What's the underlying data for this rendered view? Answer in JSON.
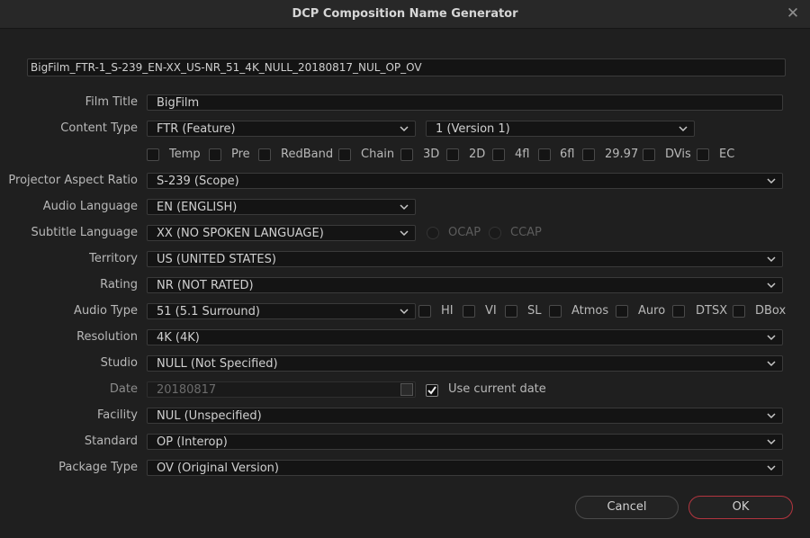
{
  "window": {
    "title": "DCP Composition Name Generator"
  },
  "generated_name": "BigFilm_FTR-1_S-239_EN-XX_US-NR_51_4K_NULL_20180817_NUL_OP_OV",
  "labels": {
    "film_title": "Film Title",
    "content_type": "Content Type",
    "projector_aspect_ratio": "Projector Aspect Ratio",
    "audio_language": "Audio Language",
    "subtitle_language": "Subtitle Language",
    "territory": "Territory",
    "rating": "Rating",
    "audio_type": "Audio Type",
    "resolution": "Resolution",
    "studio": "Studio",
    "date": "Date",
    "facility": "Facility",
    "standard": "Standard",
    "package_type": "Package Type"
  },
  "fields": {
    "film_title": "BigFilm",
    "content_type": "FTR (Feature)",
    "version": "1 (Version 1)",
    "projector_aspect_ratio": "S-239 (Scope)",
    "audio_language": "EN (ENGLISH)",
    "subtitle_language": "XX (NO SPOKEN LANGUAGE)",
    "territory": "US (UNITED STATES)",
    "rating": "NR (NOT RATED)",
    "audio_type": "51 (5.1 Surround)",
    "resolution": "4K (4K)",
    "studio": "NULL (Not Specified)",
    "date": "20180817",
    "facility": "NUL (Unspecified)",
    "standard": "OP (Interop)",
    "package_type": "OV (Original Version)"
  },
  "content_flags": [
    {
      "label": "Temp",
      "checked": false
    },
    {
      "label": "Pre",
      "checked": false
    },
    {
      "label": "RedBand",
      "checked": false
    },
    {
      "label": "Chain",
      "checked": false
    },
    {
      "label": "3D",
      "checked": false
    },
    {
      "label": "2D",
      "checked": false
    },
    {
      "label": "4fl",
      "checked": false
    },
    {
      "label": "6fl",
      "checked": false
    },
    {
      "label": "29.97",
      "checked": false
    },
    {
      "label": "DVis",
      "checked": false
    },
    {
      "label": "EC",
      "checked": false
    }
  ],
  "subtitle_options": [
    {
      "label": "OCAP",
      "selected": false
    },
    {
      "label": "CCAP",
      "selected": false
    }
  ],
  "audio_flags": [
    {
      "label": "HI",
      "checked": false
    },
    {
      "label": "VI",
      "checked": false
    },
    {
      "label": "SL",
      "checked": false
    },
    {
      "label": "Atmos",
      "checked": false
    },
    {
      "label": "Auro",
      "checked": false
    },
    {
      "label": "DTSX",
      "checked": false
    },
    {
      "label": "DBox",
      "checked": false
    }
  ],
  "use_current_date": {
    "label": "Use current date",
    "checked": true
  },
  "buttons": {
    "cancel": "Cancel",
    "ok": "OK"
  },
  "colors": {
    "ok_border": "#b3353f",
    "background": "#1f1f1f"
  }
}
